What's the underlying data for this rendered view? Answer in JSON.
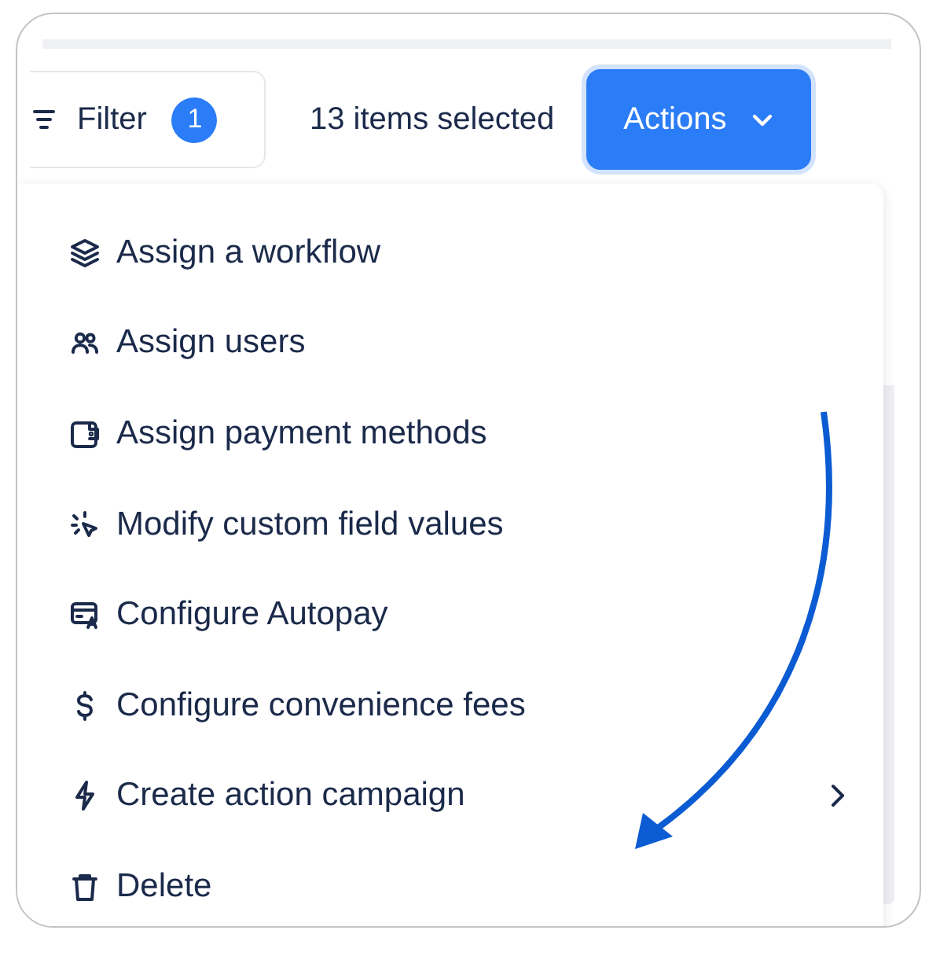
{
  "toolbar": {
    "filter": {
      "label": "Filter",
      "count": "1"
    },
    "selection": "13 items selected",
    "actions": {
      "label": "Actions",
      "expanded": true
    }
  },
  "menu": [
    {
      "label": "Assign a workflow",
      "submenu": false
    },
    {
      "label": "Assign users",
      "submenu": false
    },
    {
      "label": "Assign payment methods",
      "submenu": false
    },
    {
      "label": "Modify custom field values",
      "submenu": false
    },
    {
      "label": "Configure Autopay",
      "submenu": false
    },
    {
      "label": "Configure convenience fees",
      "submenu": false
    },
    {
      "label": "Create action campaign",
      "submenu": true
    },
    {
      "label": "Delete",
      "submenu": false
    }
  ]
}
